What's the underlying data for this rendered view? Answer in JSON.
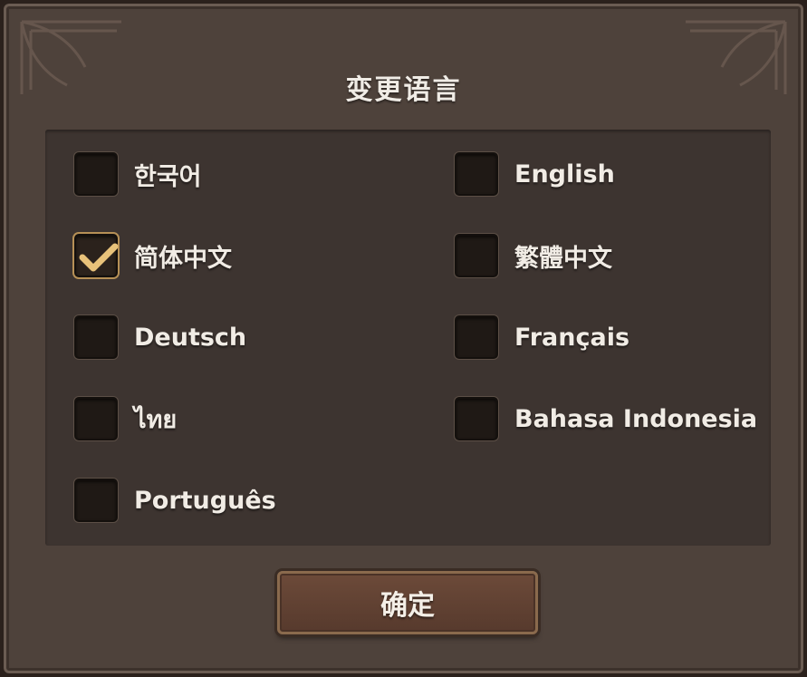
{
  "dialog": {
    "title": "变更语言",
    "confirm_label": "确定"
  },
  "languages": [
    {
      "label": "한국어",
      "checked": false
    },
    {
      "label": "English",
      "checked": false
    },
    {
      "label": "简体中文",
      "checked": true
    },
    {
      "label": "繁體中文",
      "checked": false
    },
    {
      "label": "Deutsch",
      "checked": false
    },
    {
      "label": "Français",
      "checked": false
    },
    {
      "label": "ไทย",
      "checked": false
    },
    {
      "label": "Bahasa Indonesia",
      "checked": false
    },
    {
      "label": "Português",
      "checked": false
    }
  ],
  "colors": {
    "checkmark": "#e8c27a",
    "selected_border": "#b69056",
    "button_fill": "#5f4132"
  },
  "icons": {
    "selected": "checkmark-icon",
    "ornament": "corner-ornament"
  }
}
